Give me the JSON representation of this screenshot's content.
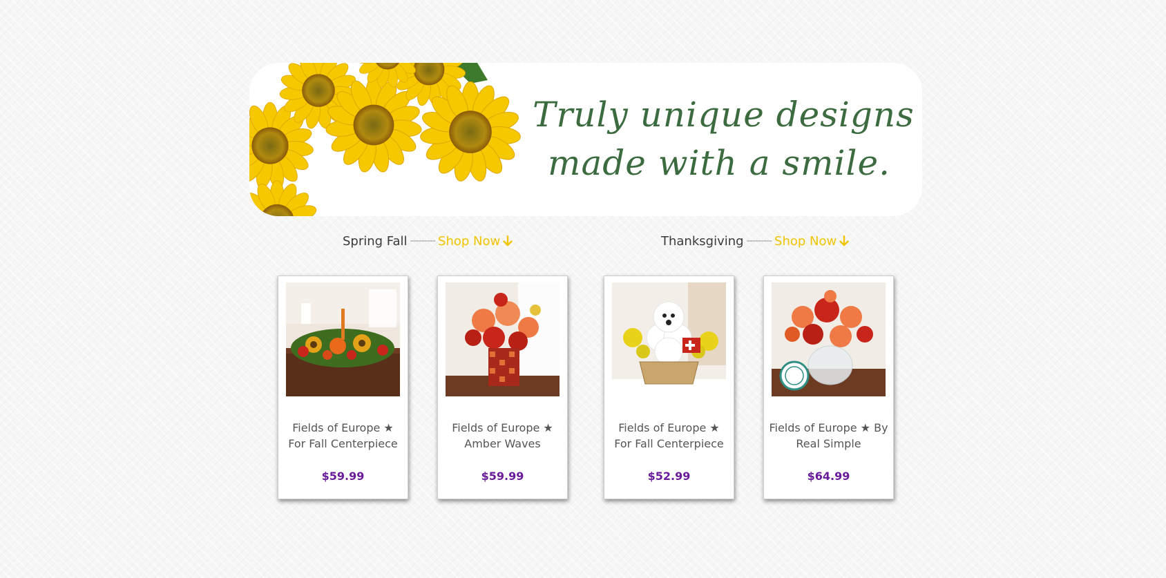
{
  "banner": {
    "tagline_line1": "Truly unique designs",
    "tagline_line2": "made with a smile."
  },
  "promos": [
    {
      "label": "Spring Fall",
      "separator": "---------",
      "link": "Shop Now"
    },
    {
      "label": "Thanksgiving",
      "separator": "---------",
      "link": "Shop Now"
    }
  ],
  "products": [
    {
      "name": "Fields of Europe ★ For Fall Centerpiece",
      "price": "$59.99"
    },
    {
      "name": "Fields of Europe ★ Amber Waves",
      "price": "$59.99"
    },
    {
      "name": "Fields of Europe ★ For Fall Centerpiece",
      "price": "$52.99"
    },
    {
      "name": "Fields of Europe ★ By Real Simple",
      "price": "$64.99"
    }
  ],
  "colors": {
    "tagline": "#3b6b3f",
    "shop_link": "#f0c400",
    "price": "#6a1b9a"
  },
  "icons": {
    "shop_arrow": "arrow-down-icon"
  }
}
